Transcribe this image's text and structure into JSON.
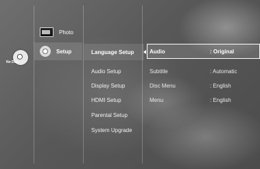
{
  "disc": {
    "status_label": "No Disc"
  },
  "main_menu": {
    "items": [
      {
        "label": "Photo",
        "icon": "photo-icon"
      },
      {
        "label": "Setup",
        "icon": "gear-icon"
      }
    ]
  },
  "setup_menu": {
    "items": [
      {
        "label": "Language Setup"
      },
      {
        "label": "Audio Setup"
      },
      {
        "label": "Display Setup"
      },
      {
        "label": "HDMI Setup"
      },
      {
        "label": "Parental Setup"
      },
      {
        "label": "System Upgrade"
      }
    ]
  },
  "language_options": {
    "rows": [
      {
        "name": "Audio",
        "value": ": Original"
      },
      {
        "name": "Subtitle",
        "value": ": Automatic"
      },
      {
        "name": "Disc Menu",
        "value": ": English"
      },
      {
        "name": "Menu",
        "value": ": English"
      }
    ]
  }
}
